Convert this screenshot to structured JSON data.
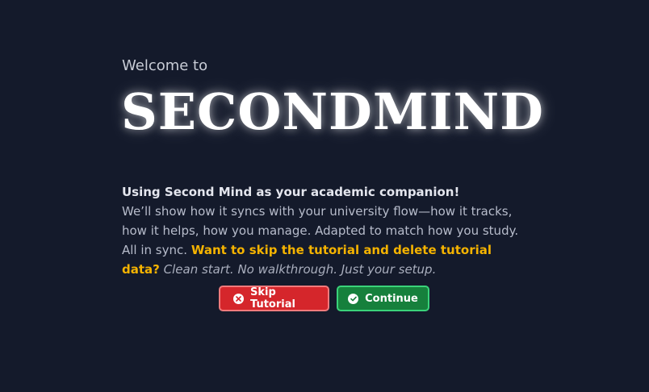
{
  "welcome": {
    "prefix": "Welcome to",
    "brand": "SECONDMIND"
  },
  "intro": {
    "heading": "Using Second Mind as your academic companion!",
    "body": "We’ll show how it syncs with your university flow—how it tracks, how it helps, how you manage. Adapted to match how you study. All in sync.",
    "warning": "Want to skip the tutorial and delete tutorial data?",
    "note": "Clean start. No walkthrough. Just your setup."
  },
  "buttons": {
    "skip_label": "Skip Tutorial",
    "continue_label": "Continue"
  },
  "icons": {
    "skip": "close-circle-icon",
    "continue": "check-circle-icon"
  },
  "colors": {
    "background": "#141a2b",
    "warning": "#f5b300",
    "skip_button": "#d5262b",
    "continue_button": "#16803c"
  }
}
